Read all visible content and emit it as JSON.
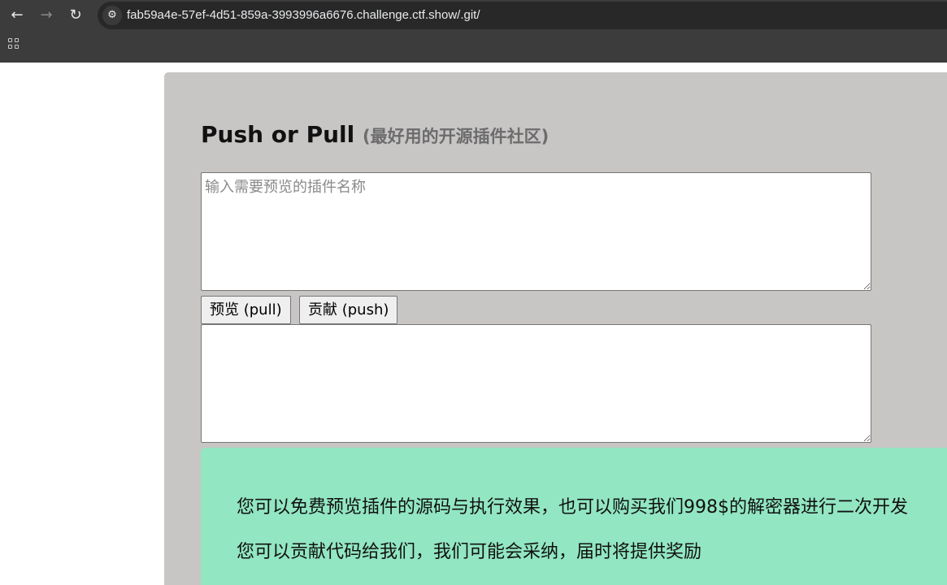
{
  "browser": {
    "back_icon": "←",
    "forward_icon": "→",
    "reload_icon": "↻",
    "site_info_icon": "⚙",
    "url": "fab59a4e-57ef-4d51-859a-3993996a6676.challenge.ctf.show/.git/"
  },
  "page": {
    "title": "Push or Pull",
    "subtitle": "(最好用的开源插件社区)",
    "input_placeholder": "输入需要预览的插件名称",
    "input_value": "",
    "output_value": "",
    "pull_button": "预览 (pull)",
    "push_button": "贡献 (push)",
    "notice_line1": "您可以免费预览插件的源码与执行效果，也可以购买我们998$的解密器进行二次开发",
    "notice_line2": "您可以贡献代码给我们，我们可能会采纳，届时将提供奖励"
  },
  "colors": {
    "card_background": "#c8c5c5",
    "notice_background": "#92e6c2",
    "chrome_background": "#3c3c3c"
  }
}
